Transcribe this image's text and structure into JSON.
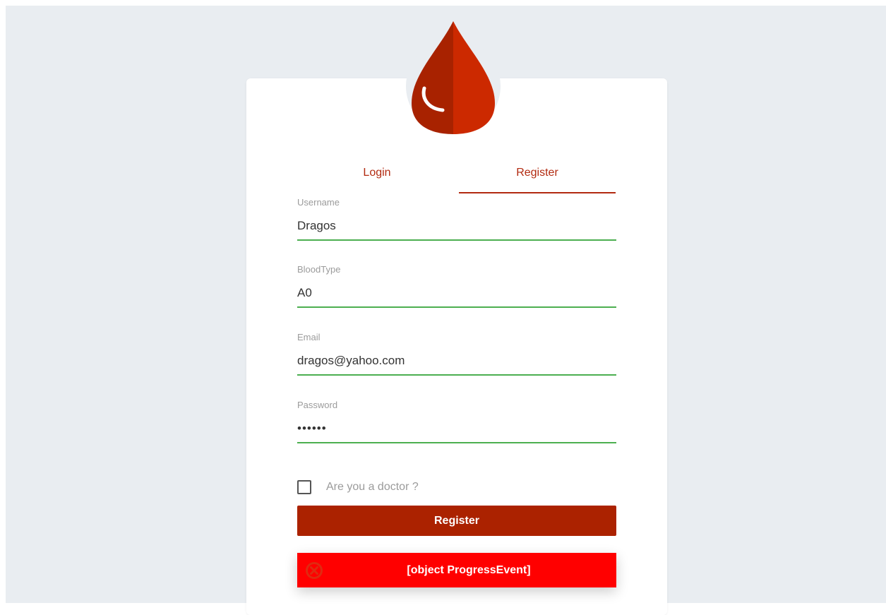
{
  "tabs": {
    "login_label": "Login",
    "register_label": "Register",
    "active": "register"
  },
  "form": {
    "username": {
      "label": "Username",
      "value": "Dragos"
    },
    "bloodtype": {
      "label": "BloodType",
      "value": "A0"
    },
    "email": {
      "label": "Email",
      "value": "dragos@yahoo.com"
    },
    "password": {
      "label": "Password",
      "value": "••••••"
    },
    "doctor_checkbox": {
      "label": "Are you a doctor ?",
      "checked": false
    },
    "submit_label": "Register"
  },
  "toast": {
    "message": "[object ProgressEvent]",
    "icon": "error-circle-icon"
  },
  "colors": {
    "brand": "#ab2200",
    "tab_accent": "#b22a10",
    "input_valid": "#4caf50",
    "toast_bg": "#ff0000",
    "page_bg": "#e9edf1"
  },
  "icons": {
    "logo": "blood-drop-icon"
  }
}
